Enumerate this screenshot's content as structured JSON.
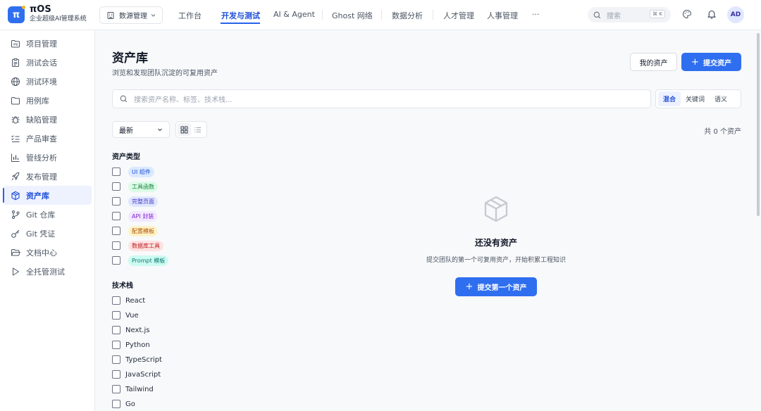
{
  "app": {
    "logo_text": "π",
    "name": "πOS",
    "subtitle": "企业超级AI管理系统",
    "workspace": "数源管理",
    "avatar": "AD",
    "accent": "#2f6fef"
  },
  "nav": {
    "tabs": [
      "工作台",
      "开发与测试",
      "AI & Agent",
      "Ghost 网络",
      "数据分析",
      "人才管理",
      "人事管理",
      "···"
    ],
    "active": "开发与测试",
    "search_placeholder": "搜索",
    "search_shortcut": "⌘ K"
  },
  "sidebar": {
    "items": [
      {
        "label": "项目管理",
        "icon": "folder-kanban-icon"
      },
      {
        "label": "测试会话",
        "icon": "clipboard-icon"
      },
      {
        "label": "测试环境",
        "icon": "globe-icon"
      },
      {
        "label": "用例库",
        "icon": "folder-icon"
      },
      {
        "label": "缺陷管理",
        "icon": "bug-icon"
      },
      {
        "label": "产品审查",
        "icon": "list-check-icon"
      },
      {
        "label": "管线分析",
        "icon": "bar-chart-icon"
      },
      {
        "label": "发布管理",
        "icon": "rocket-icon"
      },
      {
        "label": "资产库",
        "icon": "package-icon"
      },
      {
        "label": "Git 仓库",
        "icon": "git-branch-icon"
      },
      {
        "label": "Git 凭证",
        "icon": "key-icon"
      },
      {
        "label": "文档中心",
        "icon": "folder-open-icon"
      },
      {
        "label": "全托管测试",
        "icon": "play-icon"
      }
    ],
    "active": "资产库"
  },
  "main": {
    "title": "资产库",
    "subtitle": "浏览和发现团队沉淀的可复用资产",
    "my_assets_label": "我的资产",
    "submit_label": "提交资产",
    "search_placeholder": "搜索资产名称、标签、技术栈...",
    "search_modes": [
      "混合",
      "关键词",
      "语义"
    ],
    "active_mode": "混合",
    "sort_value": "最新",
    "view_mode": "grid",
    "count_text": "共 0 个资产"
  },
  "filters": {
    "asset_type_title": "资产类型",
    "asset_types": [
      {
        "label": "UI 组件",
        "bg": "#dbeafe",
        "fg": "#1d4ed8"
      },
      {
        "label": "工具函数",
        "bg": "#dcfce7",
        "fg": "#15803d"
      },
      {
        "label": "完整页面",
        "bg": "#e0e7ff",
        "fg": "#4338ca"
      },
      {
        "label": "API 封装",
        "bg": "#f3e8ff",
        "fg": "#7e22ce"
      },
      {
        "label": "配置模板",
        "bg": "#fef3c7",
        "fg": "#b45309"
      },
      {
        "label": "数据库工具",
        "bg": "#fee2e2",
        "fg": "#b91c1c"
      },
      {
        "label": "Prompt 模板",
        "bg": "#ccfbf1",
        "fg": "#0f766e"
      }
    ],
    "tech_stack_title": "技术栈",
    "tech_stack": [
      "React",
      "Vue",
      "Next.js",
      "Python",
      "TypeScript",
      "JavaScript",
      "Tailwind",
      "Go"
    ]
  },
  "empty": {
    "title": "还没有资产",
    "subtitle": "提交团队的第一个可复用资产，开始积累工程知识",
    "button_label": "提交第一个资产"
  }
}
